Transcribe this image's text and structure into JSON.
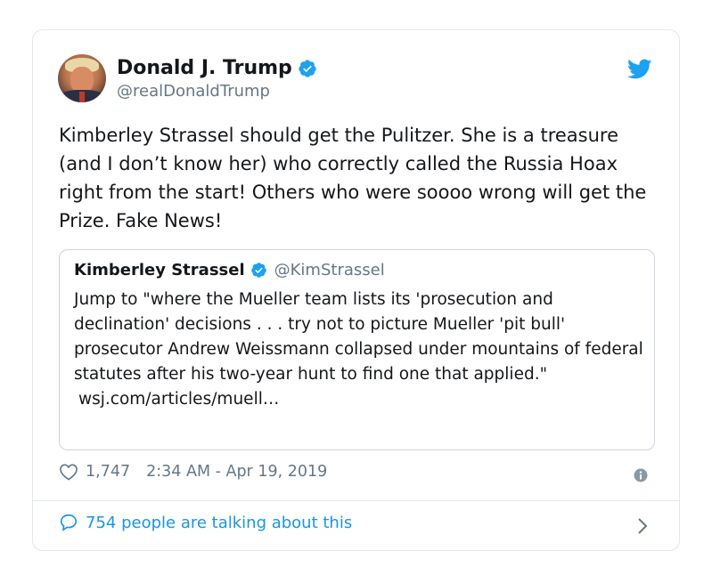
{
  "tweet": {
    "author": {
      "name": "Donald J. Trump",
      "handle": "@realDonaldTrump",
      "verified": true
    },
    "text": "Kimberley Strassel should get the Pulitzer. She is a treasure (and I don’t know her) who correctly called the Russia Hoax right from the start! Others who were soooo wrong will get the Prize. Fake News!",
    "quoted": {
      "name": "Kimberley Strassel",
      "handle": "@KimStrassel",
      "text": "Jump to \"where the Mueller team lists its 'prosecution and declination' decisions . . . try not to picture Mueller 'pit bull' prosecutor Andrew Weissmann collapsed under mountains of federal statutes after his two-year hunt to find one that applied.\"",
      "link": "wsj.com/articles/muell…"
    },
    "likes": "1,747",
    "timestamp": "2:34 AM - Apr 19, 2019",
    "talking": "754 people are talking about this"
  },
  "colors": {
    "brand_blue": "#1da1f2",
    "link_blue": "#1b95e0",
    "muted": "#657786",
    "border": "#e1e8ed"
  },
  "icons": [
    "verified-badge-icon",
    "twitter-bird-icon",
    "heart-icon",
    "info-icon",
    "speech-bubble-icon",
    "chevron-right-icon"
  ]
}
